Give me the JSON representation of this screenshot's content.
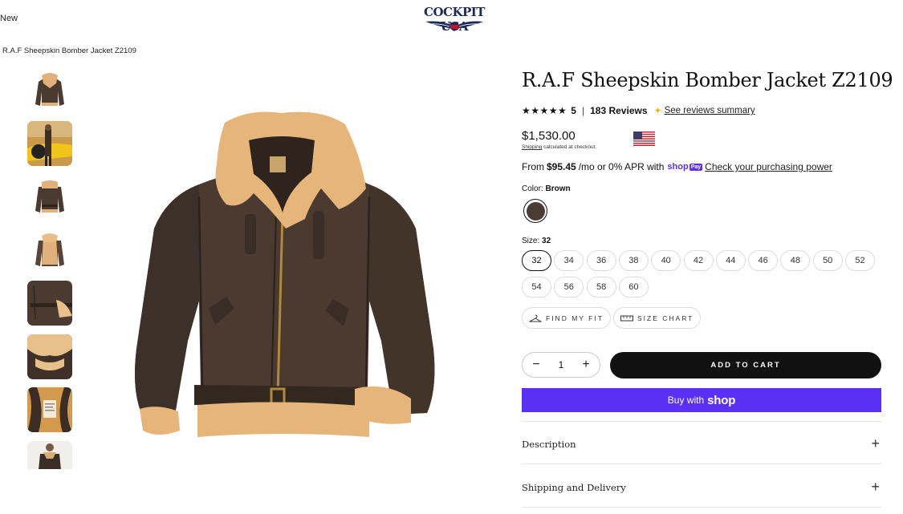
{
  "header": {
    "nav_new": "New",
    "logo_text": "COCKPIT USA"
  },
  "breadcrumb": "R.A.F Sheepskin Bomber Jacket Z2109",
  "product": {
    "title": "R.A.F Sheepskin Bomber Jacket Z2109",
    "stars": "★★★★★",
    "rating": "5",
    "separator": "|",
    "reviews": "183 Reviews",
    "reviews_summary_link": "See reviews summary",
    "price": "$1,530.00",
    "shipping_link": "Shipping",
    "shipping_note": " calculated at checkout.",
    "installments_prefix": "From",
    "installments_amount": "$95.45",
    "installments_suffix": "/mo or 0% APR with",
    "shop_pay_brand": "shop",
    "shop_pay_badge": "Pay",
    "purchasing_power_link": "Check your purchasing power",
    "color_label": "Color:",
    "color_value": "Brown",
    "color_swatch": "#4b3b35",
    "size_label": "Size:",
    "size_value": "32",
    "sizes": [
      "32",
      "34",
      "36",
      "38",
      "40",
      "42",
      "44",
      "46",
      "48",
      "50",
      "52",
      "54",
      "56",
      "58",
      "60"
    ],
    "selected_size": "32",
    "find_fit_label": "FIND MY FIT",
    "size_chart_label": "SIZE CHART",
    "quantity": "1",
    "minus_symbol": "−",
    "plus_symbol": "+",
    "add_to_cart_label": "ADD TO CART",
    "buy_with_label": "Buy with",
    "buy_with_brand": "shop",
    "accordions": [
      {
        "label": "Description",
        "icon": "plus-icon"
      },
      {
        "label": "Shipping and Delivery",
        "icon": "plus-icon"
      }
    ]
  },
  "colors": {
    "shop_pay_purple": "#5a31f4",
    "add_to_cart_bg": "#111111",
    "jacket_brown": "#4a3a30",
    "shearling": "#e5b57a"
  }
}
